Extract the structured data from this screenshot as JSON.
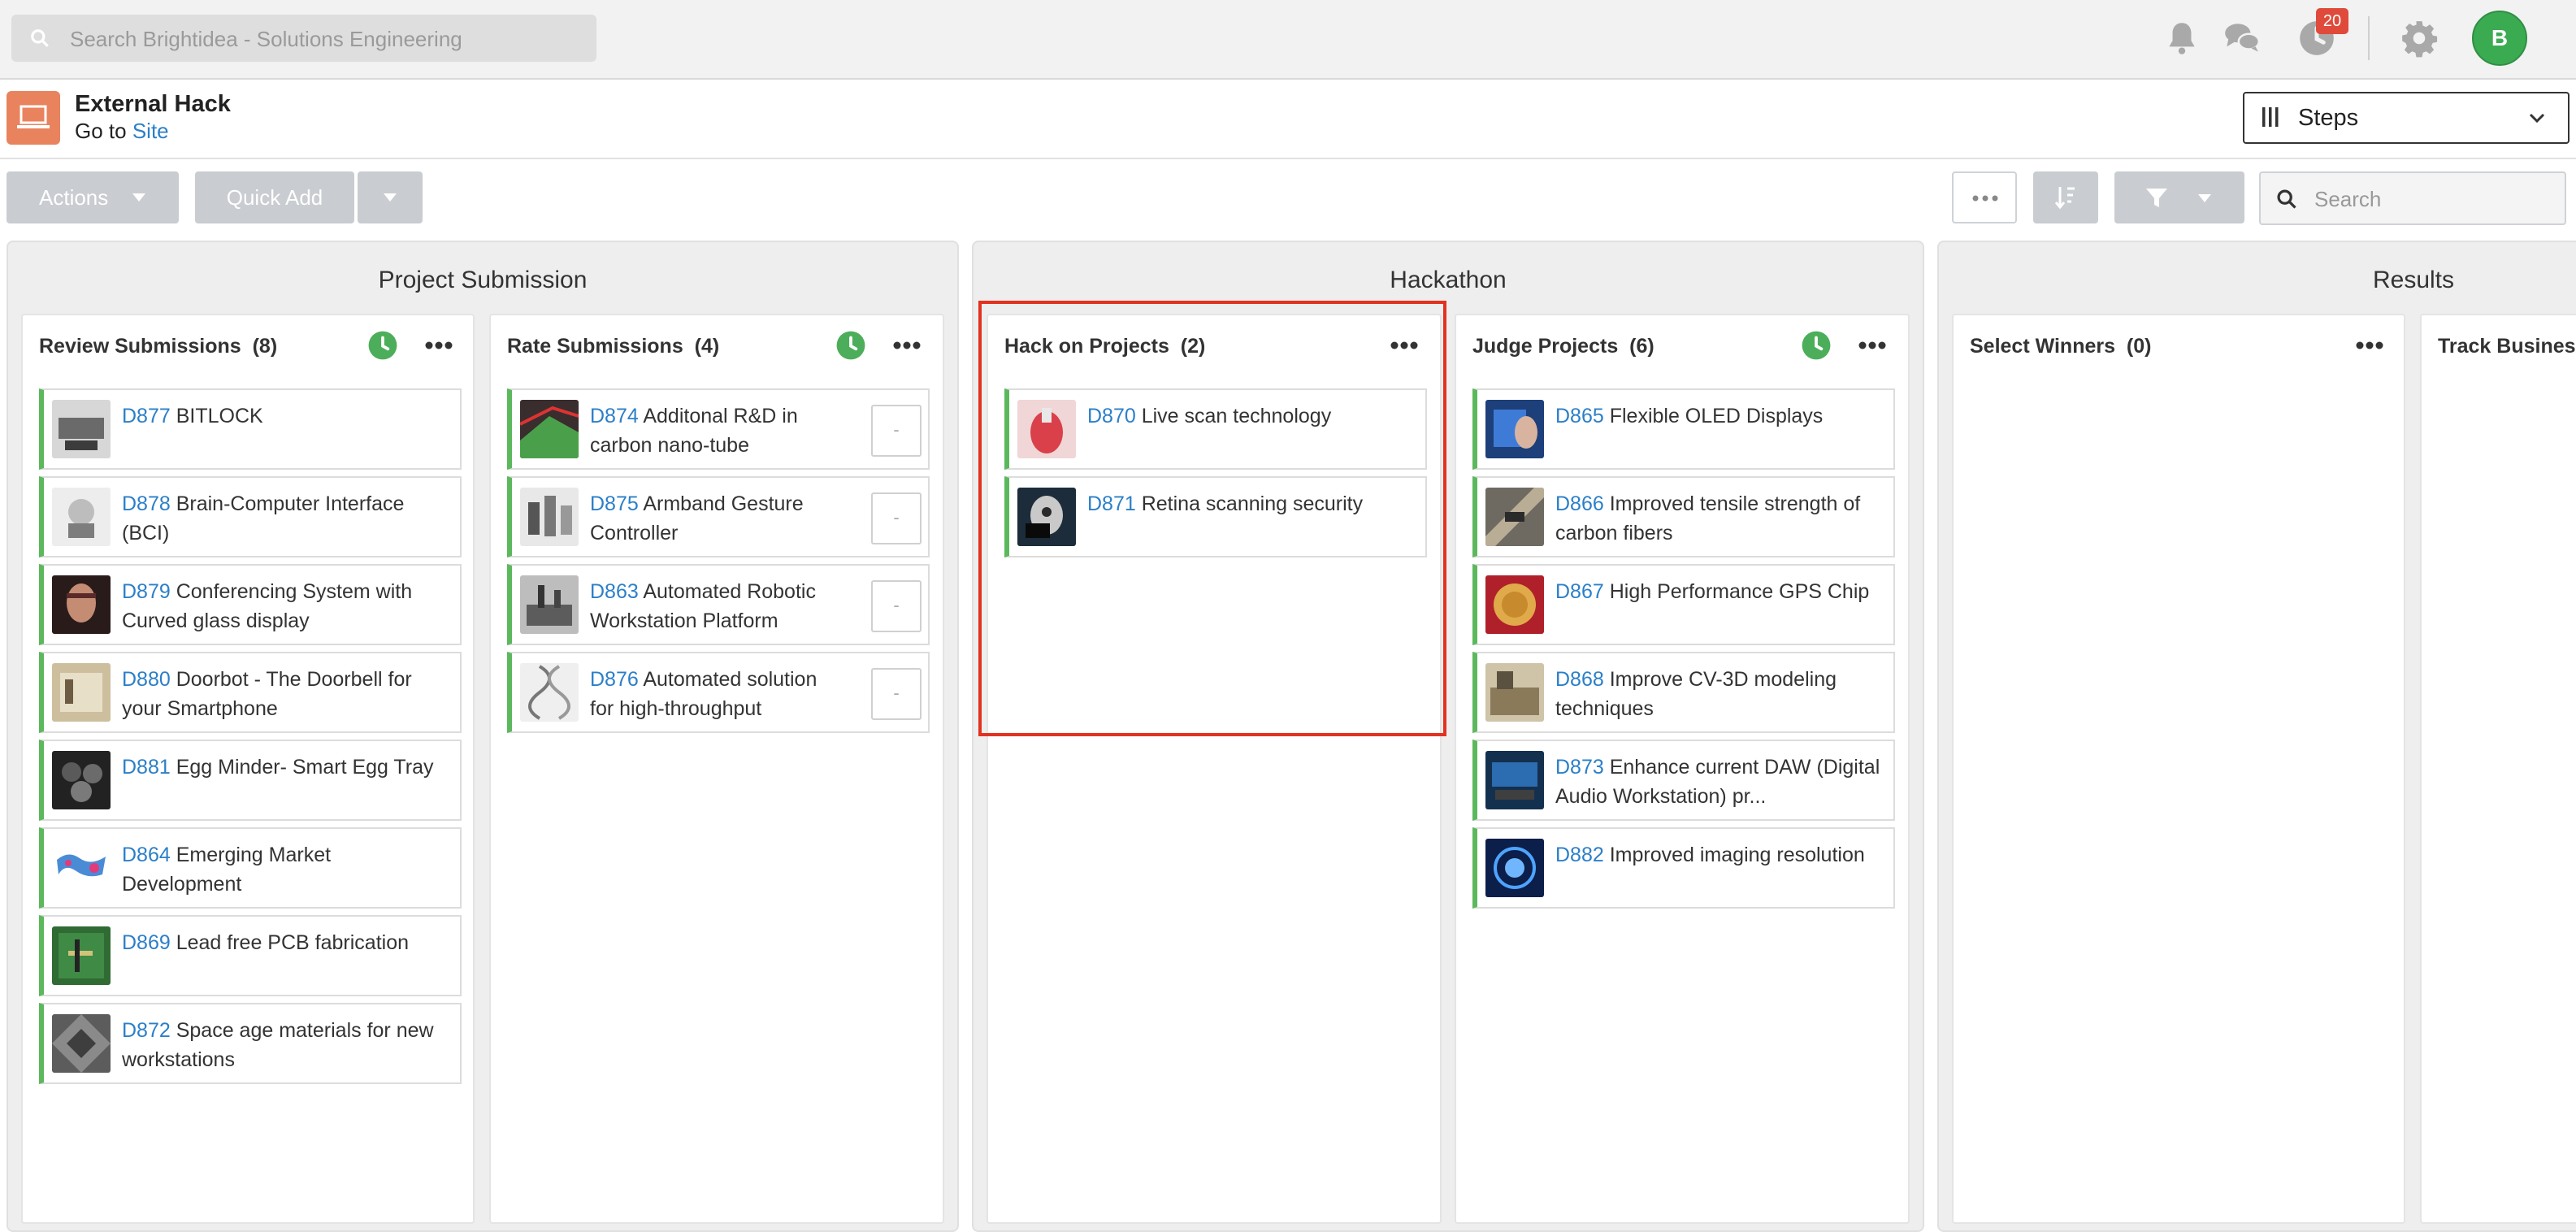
{
  "topbar": {
    "search_placeholder": "Search Brightidea - Solutions Engineering",
    "notification_count": "20",
    "avatar_initial": "B"
  },
  "header": {
    "title": "External Hack",
    "goto_prefix": "Go to",
    "goto_link": "Site",
    "steps_label": "Steps"
  },
  "toolbar": {
    "actions_label": "Actions",
    "quick_add_label": "Quick Add",
    "search_placeholder": "Search"
  },
  "colors": {
    "accent": "#2b7fc9",
    "card_bar": "#5cb85c",
    "highlight": "#e2321f",
    "app_icon": "#e8835e"
  },
  "phases": {
    "p1": "Project Submission",
    "p2": "Hackathon",
    "p3": "Results"
  },
  "columns": {
    "review": {
      "title": "Review Submissions",
      "count": "(8)"
    },
    "rate": {
      "title": "Rate Submissions",
      "count": "(4)"
    },
    "hack": {
      "title": "Hack on Projects",
      "count": "(2)"
    },
    "judge": {
      "title": "Judge Projects",
      "count": "(6)"
    },
    "select": {
      "title": "Select Winners",
      "count": "(0)"
    },
    "track": {
      "title": "Track Business"
    }
  },
  "cards": {
    "review": [
      {
        "id": "D877",
        "line1": "BITLOCK",
        "line2": ""
      },
      {
        "id": "D878",
        "line1": "Brain-Computer Interface",
        "line2": "(BCI)"
      },
      {
        "id": "D879",
        "line1": "Conferencing System with",
        "line2": "Curved glass display"
      },
      {
        "id": "D880",
        "line1": "Doorbot - The Doorbell for",
        "line2": "your Smartphone"
      },
      {
        "id": "D881",
        "line1": "Egg Minder- Smart Egg Tray",
        "line2": ""
      },
      {
        "id": "D864",
        "line1": "Emerging Market",
        "line2": "Development"
      },
      {
        "id": "D869",
        "line1": "Lead free PCB fabrication",
        "line2": ""
      },
      {
        "id": "D872",
        "line1": "Space age materials for new",
        "line2": "workstations"
      }
    ],
    "rate": [
      {
        "id": "D874",
        "line1": "Additonal R&D in",
        "line2": "carbon nano-tube",
        "score": "-"
      },
      {
        "id": "D875",
        "line1": "Armband Gesture",
        "line2": "Controller",
        "score": "-"
      },
      {
        "id": "D863",
        "line1": "Automated Robotic",
        "line2": "Workstation Platform",
        "score": "-"
      },
      {
        "id": "D876",
        "line1": "Automated solution",
        "line2": "for high-throughput",
        "score": "-"
      }
    ],
    "hack": [
      {
        "id": "D870",
        "line1": "Live scan technology",
        "line2": ""
      },
      {
        "id": "D871",
        "line1": "Retina scanning security",
        "line2": ""
      }
    ],
    "judge": [
      {
        "id": "D865",
        "line1": "Flexible OLED Displays",
        "line2": ""
      },
      {
        "id": "D866",
        "line1": "Improved tensile strength of",
        "line2": "carbon fibers"
      },
      {
        "id": "D867",
        "line1": "High Performance GPS Chip",
        "line2": ""
      },
      {
        "id": "D868",
        "line1": "Improve CV-3D modeling",
        "line2": "techniques"
      },
      {
        "id": "D873",
        "line1": "Enhance current DAW (Digital",
        "line2": "Audio Workstation) pr..."
      },
      {
        "id": "D882",
        "line1": "Improved imaging resolution",
        "line2": ""
      }
    ]
  },
  "icons": [
    "search-icon",
    "bell-icon",
    "chat-icon",
    "clock-icon",
    "gear-icon",
    "laptop-icon",
    "chevron-down-icon",
    "more-icon",
    "sort-icon",
    "filter-icon"
  ]
}
